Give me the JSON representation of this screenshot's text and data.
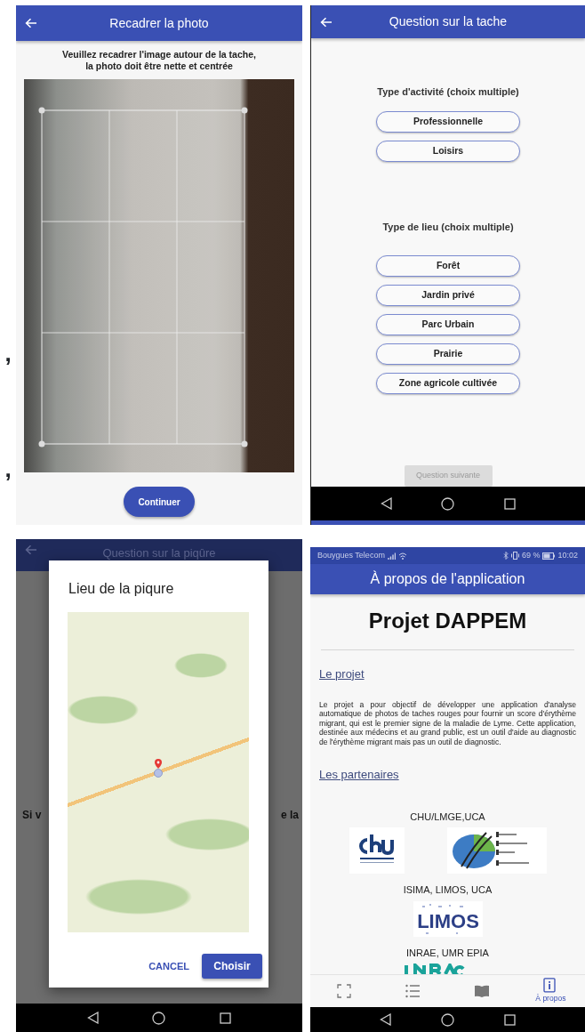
{
  "stray_marks": [
    ",",
    ","
  ],
  "crop_screen": {
    "title": "Recadrer la photo",
    "instruction_lines": [
      "Veuillez recadrer l'image autour de la tache,",
      "la photo doit être nette et centrée"
    ],
    "continue_button": "Continuer"
  },
  "question_screen": {
    "title": "Question sur la tache",
    "groups": [
      {
        "heading": "Type d'activité (choix multiple)",
        "options": [
          {
            "label": "Professionnelle",
            "selected": false
          },
          {
            "label": "Loisirs",
            "selected": false
          }
        ]
      },
      {
        "heading": "Type de lieu (choix multiple)",
        "options": [
          {
            "label": "Forêt",
            "selected": false
          },
          {
            "label": "Jardin privé",
            "selected": false
          },
          {
            "label": "Parc Urbain",
            "selected": false
          },
          {
            "label": "Prairie",
            "selected": false
          },
          {
            "label": "Zone agricole cultivée",
            "selected": false
          }
        ]
      }
    ],
    "next_button": {
      "label": "Question suivante",
      "disabled": true
    }
  },
  "map_screen": {
    "title": "Question sur la piqûre",
    "background_text_left": "Si v",
    "background_text_right": "e la",
    "dialog": {
      "title": "Lieu de la piqure",
      "cancel_button": "CANCEL",
      "confirm_button": "Choisir"
    }
  },
  "about_screen": {
    "status_bar": {
      "carrier": "Bouygues Telecom",
      "battery": "69 %",
      "time": "10:02"
    },
    "title": "À propos de l'application",
    "heading": "Projet DAPPEM",
    "sections": [
      {
        "title": "Le projet",
        "text": "Le projet a pour objectif de développer une application d'analyse automatique de photos de taches rouges pour fournir un score d'érythème migrant, qui est le premier signe de la maladie de Lyme. Cette application, destinée aux médecins et au grand public, est un outil d'aide au diagnostic de l'érythème migrant mais pas un outil de diagnostic."
      },
      {
        "title": "Les partenaires"
      }
    ],
    "partners": [
      {
        "name": "CHU/LMGE,UCA",
        "logos": [
          {
            "kind": "chu"
          },
          {
            "kind": "lmge"
          }
        ]
      },
      {
        "name": "ISIMA, LIMOS, UCA",
        "logos": [
          {
            "kind": "limos",
            "wordmark": "LIMOS"
          }
        ]
      },
      {
        "name": "INRAE, UMR EPIA",
        "logos": [
          {
            "kind": "inrae"
          }
        ]
      }
    ],
    "bottom_nav": [
      {
        "kind": "crop",
        "selected": false
      },
      {
        "kind": "list",
        "selected": false
      },
      {
        "kind": "book",
        "selected": false
      },
      {
        "kind": "info",
        "label": "À propos",
        "selected": true
      }
    ]
  }
}
